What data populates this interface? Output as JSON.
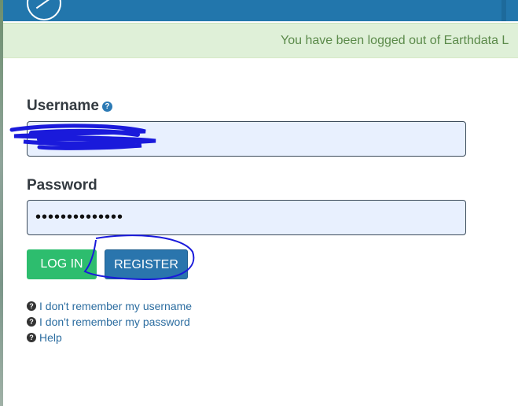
{
  "alert": {
    "message": "You have been logged out of Earthdata L"
  },
  "form": {
    "username_label": "Username",
    "username_help_icon": "?",
    "password_label": "Password",
    "password_value": "••••••••••••••",
    "login_label": "LOG IN",
    "register_label": "REGISTER"
  },
  "links": [
    {
      "icon": "question-circle-icon",
      "label": "I don't remember my username"
    },
    {
      "icon": "question-circle-icon",
      "label": "I don't remember my password"
    },
    {
      "icon": "question-circle-icon",
      "label": "Help"
    }
  ],
  "colors": {
    "header": "#2276ac",
    "alert_bg": "#dff0d8",
    "login_button": "#2dbd6e",
    "register_button": "#2a75ad",
    "annotation": "#1a1adb"
  }
}
